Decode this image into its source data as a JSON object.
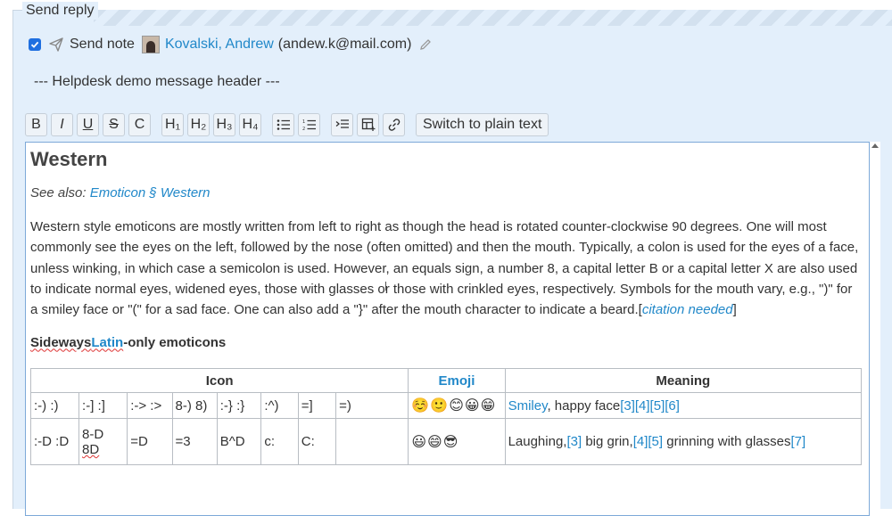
{
  "reply": {
    "legend": "Send reply",
    "send_note_label": "Send note",
    "recipient_name": "Kovalski, Andrew",
    "recipient_email": "(andew.k@mail.com)",
    "header_line": "--- Helpdesk demo message header ---"
  },
  "toolbar": {
    "bold": "B",
    "italic": "I",
    "underline": "U",
    "strike": "S",
    "code": "C",
    "h1": "H₁",
    "h2": "H₂",
    "h3": "H₃",
    "h4": "H₄",
    "plain_text": "Switch to plain text"
  },
  "article": {
    "heading": "Western",
    "see_also_prefix": "See also: ",
    "see_also_link": "Emoticon § Western",
    "paragraph": "Western style emoticons are mostly written from left to right as though the head is rotated counter-clockwise 90 degrees. One will most commonly see the eyes on the left, followed by the nose (often omitted) and then the mouth. Typically, a colon is used for the eyes of a face, unless winking, in which case a semicolon is used. However, an equals sign, a number 8, a capital letter B or a capital letter X are also used to indicate normal eyes, widened eyes, those with glasses or those with crinkled eyes, respectively. Symbols for the mouth vary, e.g., \")\" for a smiley face or \"(\" for a sad face. One can also add a \"}\" after the mouth character to indicate a beard.",
    "cite_open": "[",
    "cite_text": "citation needed",
    "cite_close": "]",
    "sub_heading_1": "Sideways",
    "sub_heading_link": "Latin",
    "sub_heading_2": "-only emoticons"
  },
  "table": {
    "headers": {
      "icon": "Icon",
      "emoji": "Emoji",
      "meaning": "Meaning"
    },
    "row1": {
      "icons": [
        ":-) :)",
        ":-] :]",
        ":-> :>",
        "8-) 8)",
        ":-} :}",
        ":^)",
        "=]",
        "=)"
      ],
      "emoji": "☺️🙂😊😀😁",
      "meaning_link": "Smiley",
      "meaning_text": ", happy face",
      "refs": "[3][4][5][6]"
    },
    "row2": {
      "icons": [
        ":-D :D",
        "8-D",
        "=D",
        "=3",
        "B^D",
        "c:",
        "C:"
      ],
      "icon_8d_2": "8D",
      "emoji": "😃😄😎",
      "meaning_1": "Laughing,",
      "ref_a": "[3]",
      "meaning_2": " big grin,",
      "ref_b": "[4][5]",
      "meaning_3": " grinning with glasses",
      "ref_c": "[7]"
    }
  },
  "colors": {
    "accent": "#2188c9",
    "panel": "#e3effb",
    "checkbox": "#1f6fe0"
  }
}
